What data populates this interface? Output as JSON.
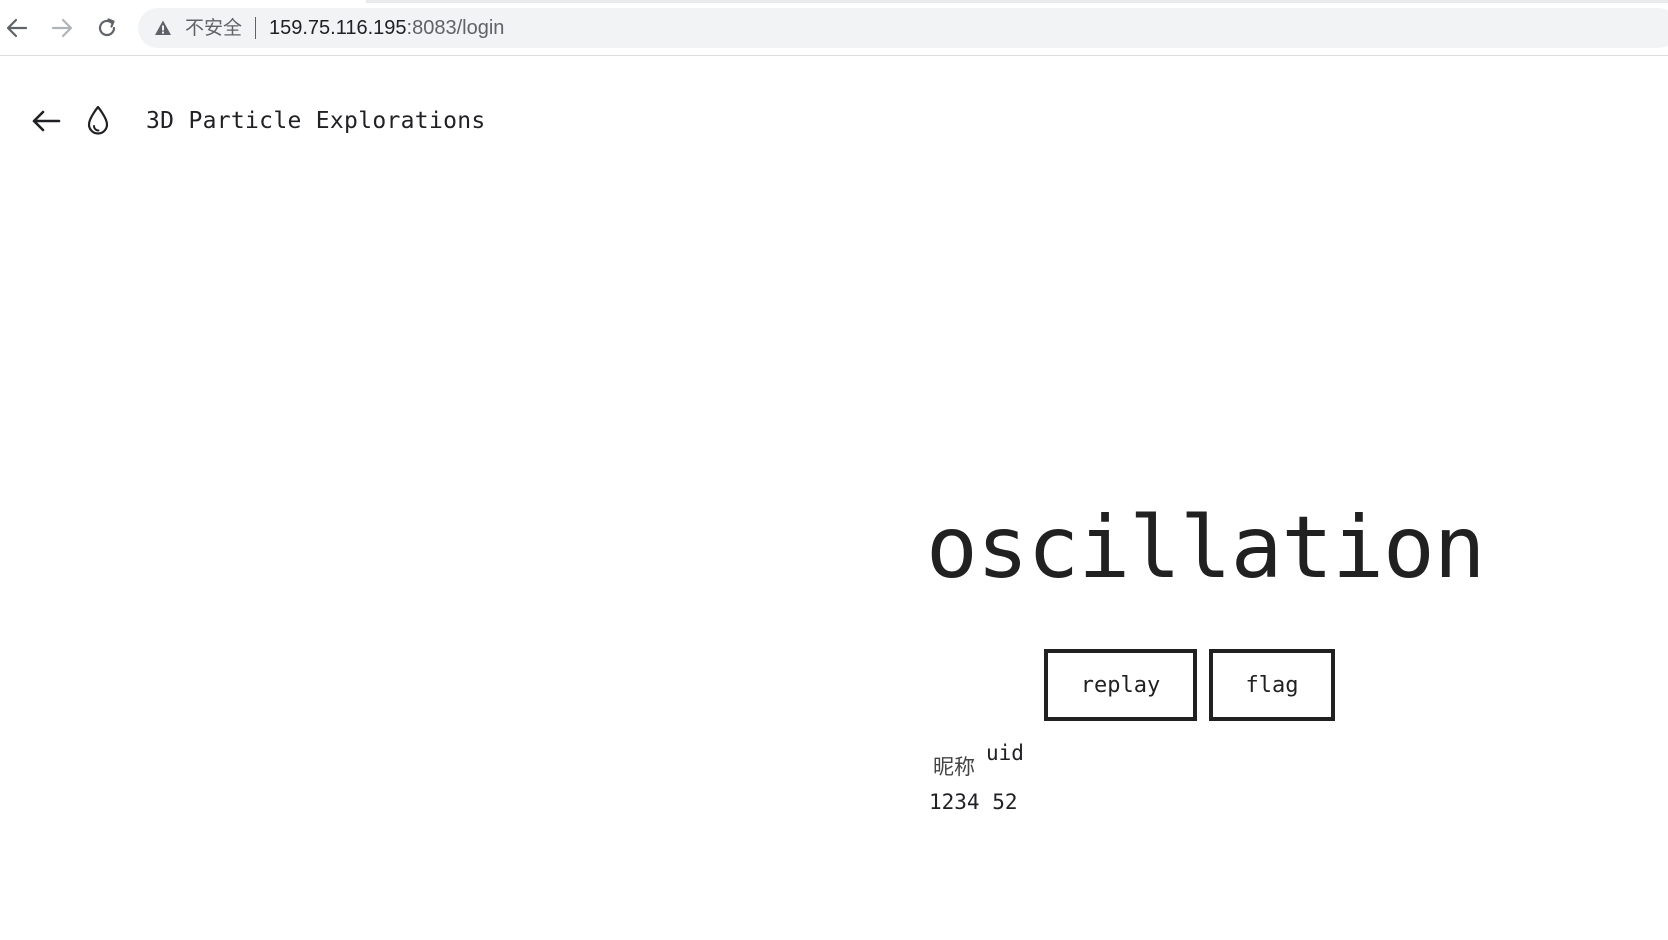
{
  "browser": {
    "not_secure_label": "不安全",
    "url_host": "159.75.116.195",
    "url_rest": ":8083/login"
  },
  "header": {
    "title": "3D Particle Explorations"
  },
  "main": {
    "title": "oscillation",
    "replay_label": "replay",
    "flag_label": "flag",
    "nickname_label": "昵称",
    "uid_label": "uid",
    "nickname_value": "1234",
    "uid_value": "52"
  },
  "colors": {
    "text": "#202124",
    "button_border": "#212121",
    "omnibox_bg": "#f1f3f4"
  },
  "icons": {
    "nav_back": "arrow-left-icon",
    "nav_forward": "arrow-right-icon",
    "nav_reload": "reload-icon",
    "warning": "warning-triangle-icon",
    "page_back": "arrow-left-icon",
    "logo": "water-drop-icon"
  }
}
